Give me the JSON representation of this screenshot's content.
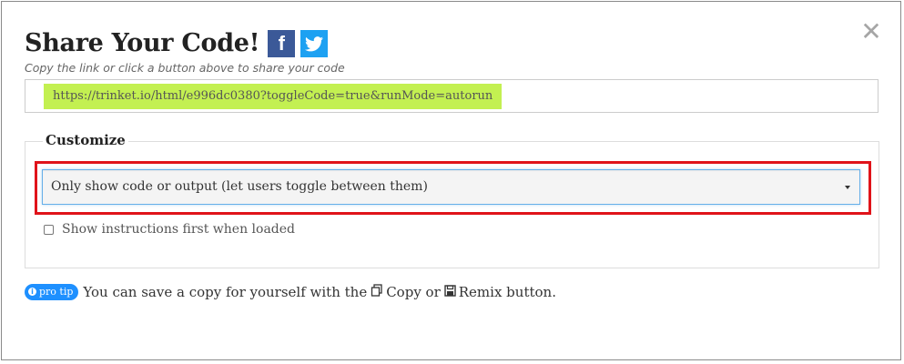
{
  "modal": {
    "title": "Share Your Code!",
    "close_glyph": "✕",
    "social": {
      "facebook_glyph": "f",
      "twitter_glyph": "🐦"
    },
    "subtitle": "Copy the link or click a button above to share your code",
    "share_link": "https://trinket.io/html/e996dc0380?toggleCode=true&runMode=autorun"
  },
  "customize": {
    "legend": "Customize",
    "display_option_selected": "Only show code or output (let users toggle between them)",
    "show_instructions_label": "Show instructions first when loaded",
    "show_instructions_checked": false
  },
  "tip": {
    "badge": "pro tip",
    "text_before": "You can save a copy for yourself with the",
    "copy_label": "Copy or",
    "remix_label": "Remix button."
  },
  "colors": {
    "highlight": "#c3f051",
    "annotation_border": "#e0131a",
    "facebook": "#3b5998",
    "twitter": "#1da1f2",
    "pro_tip": "#1e90ff"
  }
}
